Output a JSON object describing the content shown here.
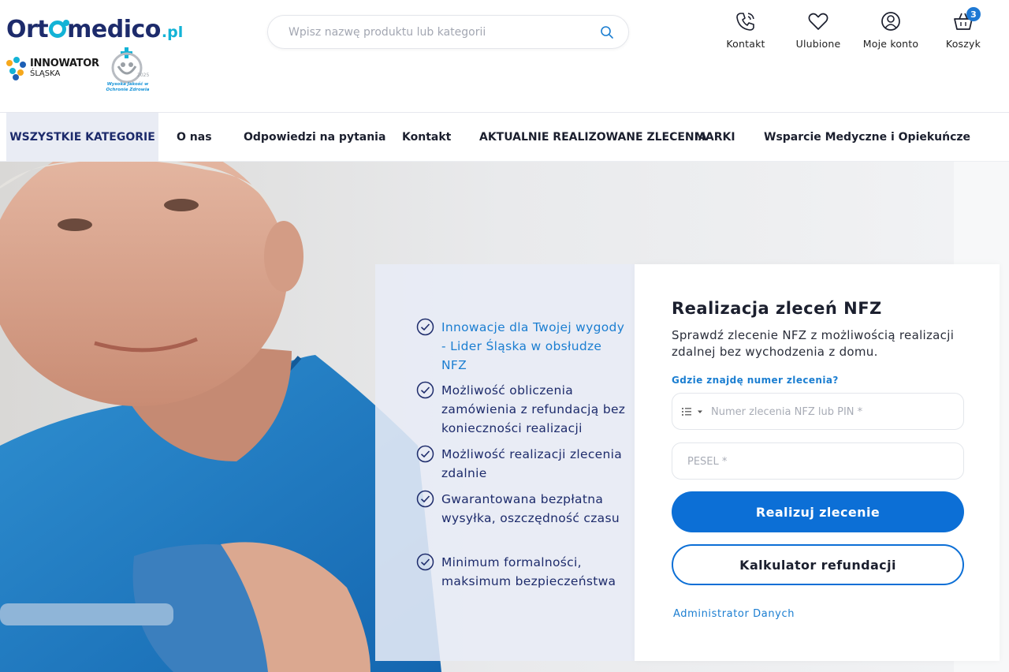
{
  "brand": {
    "logo_main": "Ortomedico",
    "logo_tld": ".pl",
    "badge1_line1": "INNOWATOR",
    "badge1_line2": "ŚLĄSKA",
    "badge2_text": "Wysoka Jakość w Ochronie Zdrowia",
    "badge2_year": "2025"
  },
  "search": {
    "placeholder": "Wpisz nazwę produktu lub kategorii"
  },
  "header_actions": [
    {
      "label": "Kontakt",
      "icon": "phone-icon"
    },
    {
      "label": "Ulubione",
      "icon": "heart-icon"
    },
    {
      "label": "Moje konto",
      "icon": "user-icon"
    },
    {
      "label": "Koszyk",
      "icon": "basket-icon",
      "badge": "3"
    }
  ],
  "nav": {
    "items": [
      "WSZYSTKIE KATEGORIE",
      "O nas",
      "Odpowiedzi na pytania",
      "Kontakt",
      "AKTUALNIE REALIZOWANE ZLECENIA",
      "MARKI",
      "Wsparcie Medyczne i Opiekuńcze"
    ]
  },
  "benefits": [
    "Innowacje dla Twojej wygody - Lider Śląska w obsłudze NFZ",
    "Możliwość obliczenia zamówienia z refundacją bez konieczności realizacji",
    "Możliwość realizacji zlecenia zdalnie",
    "Gwarantowana bezpłatna wysyłka, oszczędność czasu",
    "Minimum formalności, maksimum bezpieczeństwa"
  ],
  "form": {
    "title": "Realizacja zleceń NFZ",
    "subtitle": "Sprawdź zlecenie NFZ z możliwością realizacji zdalnej bez wychodzenia z domu.",
    "help_link": "Gdzie znajdę numer zlecenia?",
    "order_placeholder": "Numer zlecenia NFZ lub PIN *",
    "pesel_placeholder": "PESEL *",
    "submit_label": "Realizuj zlecenie",
    "calculator_label": "Kalkulator refundacji",
    "admin_link": "Administrator Danych"
  },
  "colors": {
    "brand_navy": "#1d2b6b",
    "brand_cyan": "#13b3d6",
    "accent_blue": "#0c6fd6",
    "link_blue": "#1b7ed1"
  }
}
